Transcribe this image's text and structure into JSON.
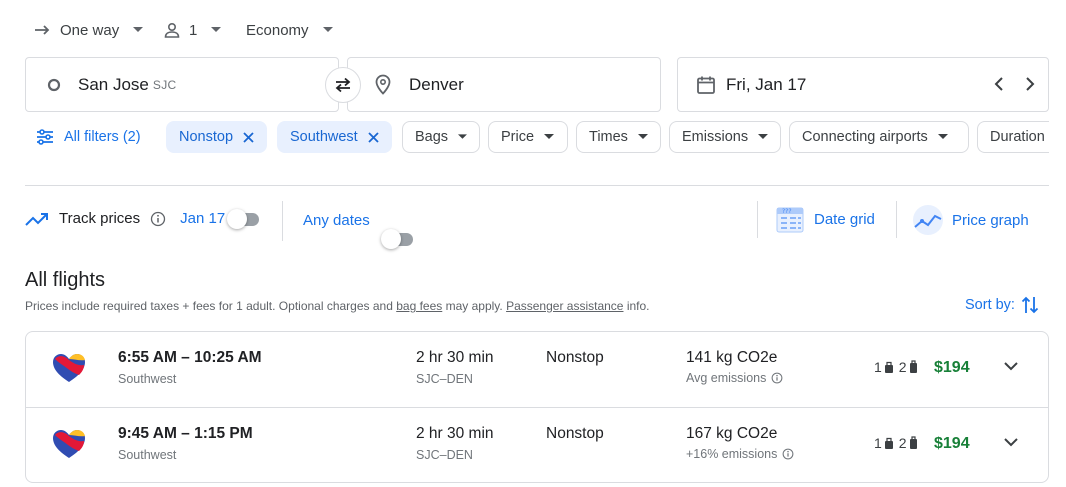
{
  "selectors": {
    "trip_type": "One way",
    "passengers": "1",
    "cabin": "Economy"
  },
  "search": {
    "origin": "San Jose",
    "origin_code": "SJC",
    "destination": "Denver",
    "date": "Fri, Jan 17"
  },
  "filters": {
    "all_filters": "All filters (2)",
    "active": [
      "Nonstop",
      "Southwest"
    ],
    "dropdowns": [
      "Bags",
      "Price",
      "Times",
      "Emissions",
      "Connecting airports",
      "Duration"
    ]
  },
  "track": {
    "label": "Track prices",
    "date": "Jan 17",
    "any_dates": "Any dates"
  },
  "tools": {
    "date_grid": "Date grid",
    "price_graph": "Price graph"
  },
  "results": {
    "title": "All flights",
    "note_prefix": "Prices include required taxes + fees for 1 adult. Optional charges and ",
    "bag_fees": "bag fees",
    "note_mid": " may apply. ",
    "passenger_assistance": "Passenger assistance",
    "note_suffix": " info.",
    "sort_label": "Sort by:",
    "flights": [
      {
        "times": "6:55 AM – 10:25 AM",
        "airline": "Southwest",
        "duration": "2 hr 30 min",
        "route": "SJC–DEN",
        "stops": "Nonstop",
        "emissions": "141 kg CO2e",
        "emissions_note": "Avg emissions",
        "carry_on": "1",
        "checked": "2",
        "price": "$194"
      },
      {
        "times": "9:45 AM – 1:15 PM",
        "airline": "Southwest",
        "duration": "2 hr 30 min",
        "route": "SJC–DEN",
        "stops": "Nonstop",
        "emissions": "167 kg CO2e",
        "emissions_note": "+16% emissions",
        "carry_on": "1",
        "checked": "2",
        "price": "$194"
      }
    ]
  },
  "colors": {
    "accent": "#1a73e8",
    "chip_active_bg": "#e8f0fe",
    "price": "#188038",
    "border": "#dadce0"
  }
}
